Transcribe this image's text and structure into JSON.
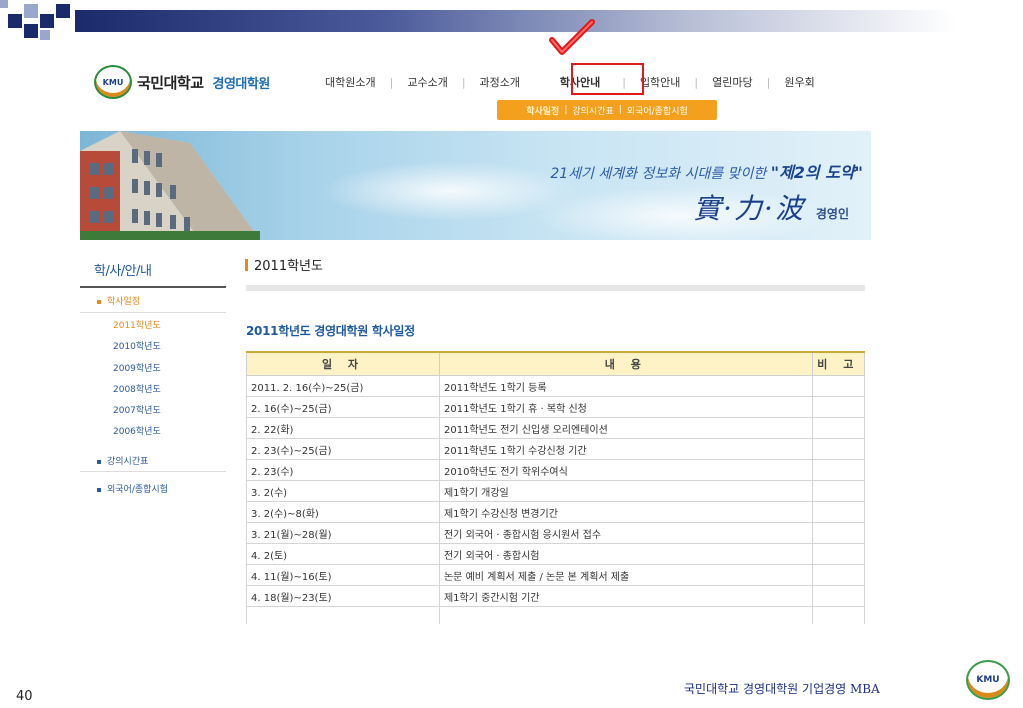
{
  "header": {
    "university": "국민대학교",
    "school": "경영대학원",
    "logo_text": "KMU"
  },
  "gnb": {
    "items": [
      "대학원소개",
      "교수소개",
      "과정소개",
      "학사안내",
      "입학안내",
      "열린마당",
      "원우회"
    ]
  },
  "subnav": {
    "items": [
      "학사일정",
      "강의시간표",
      "외국어/종합시험"
    ]
  },
  "banner": {
    "slogan_prefix": "21세기 세계화 정보화 시대를 맞이한 ",
    "slogan_emph": "\"제2의 도약\"",
    "slogan_hanja": "實·力·波",
    "slogan_suffix": "경영인"
  },
  "sidebar": {
    "title": "학/사/안/내",
    "menu1": "학사일정",
    "years": [
      "2011학년도",
      "2010학년도",
      "2009학년도",
      "2008학년도",
      "2007학년도",
      "2006학년도"
    ],
    "menu2": "강의시간표",
    "menu3": "외국어/종합시험"
  },
  "content": {
    "heading": "2011학년도",
    "table_title": "2011학년도 경영대학원 학사일정",
    "columns": [
      "일 자",
      "내 용",
      "비 고"
    ],
    "rows": [
      [
        "2011. 2. 16(수)~25(금)",
        "2011학년도 1학기 등록",
        ""
      ],
      [
        "2. 16(수)~25(금)",
        "2011학년도 1학기 휴 · 복학 신청",
        ""
      ],
      [
        "2. 22(화)",
        "2011학년도 전기 신입생 오리엔테이션",
        ""
      ],
      [
        "2. 23(수)~25(금)",
        "2011학년도 1학기 수강신청 기간",
        ""
      ],
      [
        "2. 23(수)",
        "2010학년도 전기 학위수여식",
        ""
      ],
      [
        "3. 2(수)",
        "제1학기 개강일",
        ""
      ],
      [
        "3. 2(수)~8(화)",
        "제1학기 수강신청 변경기간",
        ""
      ],
      [
        "3. 21(월)~28(월)",
        "전기 외국어 · 종합시험 응시원서 접수",
        ""
      ],
      [
        "4. 2(토)",
        "전기 외국어 · 종합시험",
        ""
      ],
      [
        "4. 11(월)~16(토)",
        "논문 예비 계획서 제출 / 논문 본 계획서 제출",
        ""
      ],
      [
        "4. 18(월)~23(토)",
        "제1학기 중간시험 기간",
        ""
      ],
      [
        "",
        "",
        ""
      ]
    ]
  },
  "footer": {
    "slide_number": "40",
    "caption": "국민대학교 경영대학원 기업경영 MBA",
    "logo_text": "KMU"
  },
  "colors": {
    "accent_orange": "#f2a01d",
    "link_blue": "#1f5aa0",
    "highlight_red": "#e01a1a"
  }
}
